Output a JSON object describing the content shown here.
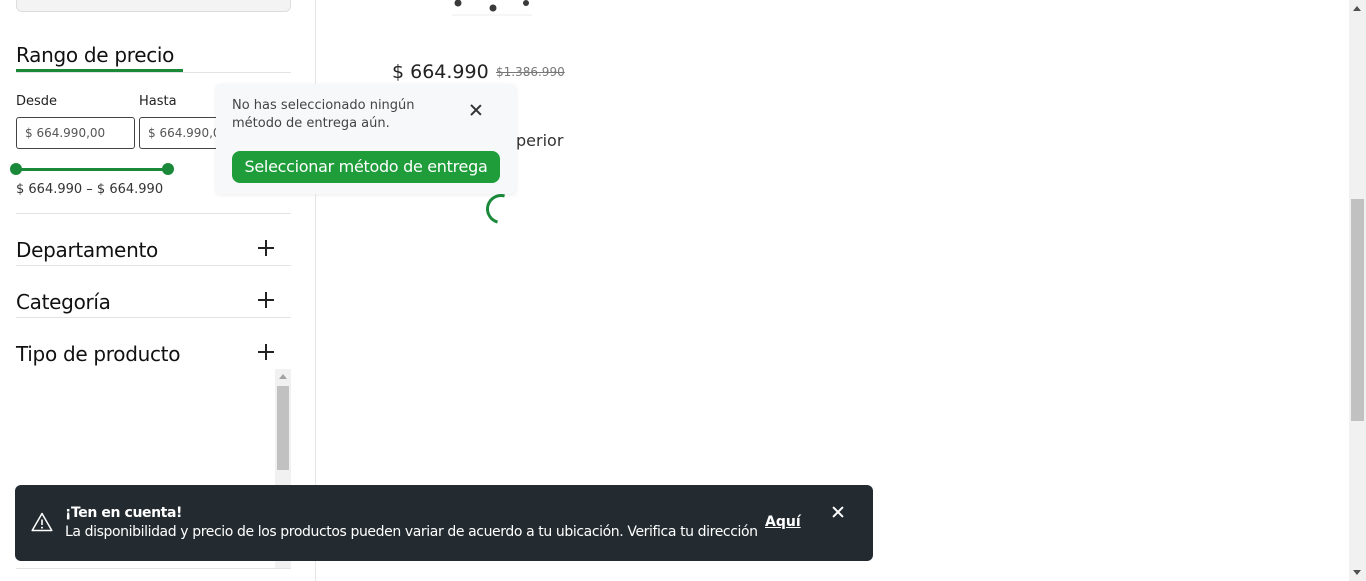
{
  "sidebar": {
    "price_range": {
      "title": "Rango de precio",
      "from_label": "Desde",
      "to_label": "Hasta",
      "from_value": "$ 664.990,00",
      "to_value": "$ 664.990,00",
      "range_text": "$ 664.990 – $ 664.990"
    },
    "filters": [
      {
        "label": "Departamento"
      },
      {
        "label": "Categoría"
      },
      {
        "label": "Tipo de producto"
      }
    ]
  },
  "product": {
    "price": "$ 664.990",
    "old_price": "$1.386.990",
    "partial_text": "perior"
  },
  "popover": {
    "message": "No has seleccionado ningún método de entrega aún.",
    "button_label": "Seleccionar método de entrega"
  },
  "toast": {
    "title": "¡Ten en cuenta!",
    "body": "La disponibilidad y precio de los productos pueden variar de acuerdo a tu ubicación. Verifica tu dirección",
    "link_label": "Aquí"
  },
  "colors": {
    "accent": "#1a8a3a",
    "button": "#1e9d3a",
    "toast_bg": "#232b30"
  }
}
